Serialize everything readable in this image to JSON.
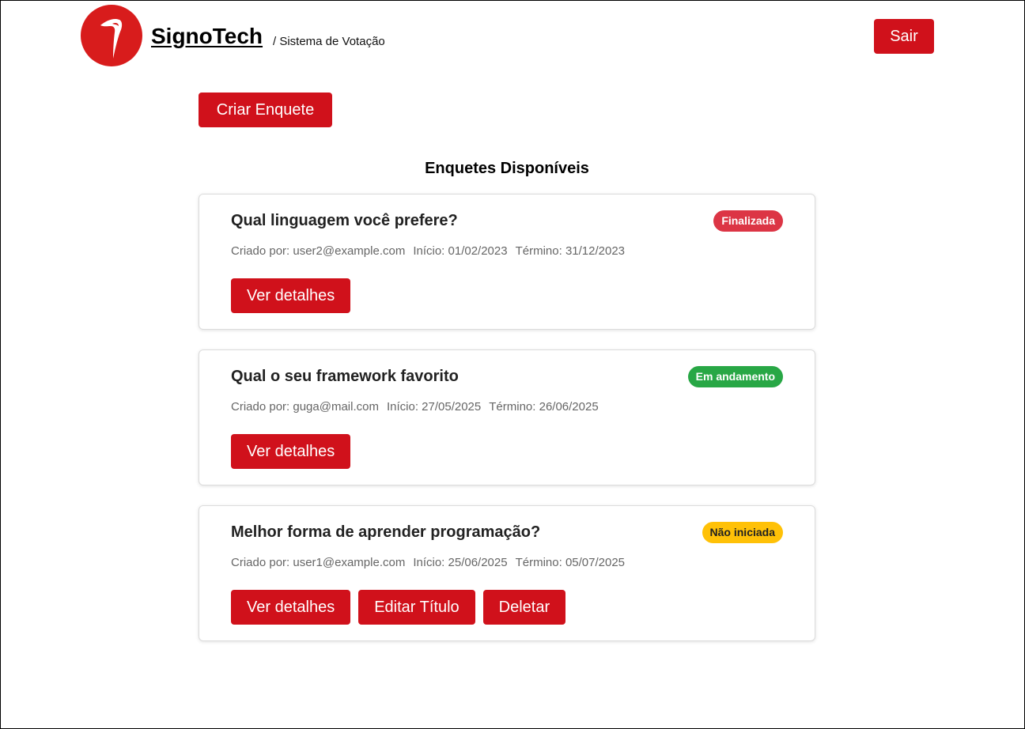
{
  "header": {
    "brand": "SignoTech",
    "subtitle": "/ Sistema de Votação",
    "logout_label": "Sair",
    "logo_color": "#d81c1c"
  },
  "toolbar": {
    "create_label": "Criar Enquete"
  },
  "section": {
    "title": "Enquetes Disponíveis"
  },
  "polls": [
    {
      "title": "Qual linguagem você prefere?",
      "status": "Finalizada",
      "status_color": "#dc3545",
      "status_text_color": "#ffffff",
      "created_by": "Criado por: user2@example.com",
      "start": "Início: 01/02/2023",
      "end": "Término: 31/12/2023",
      "actions": [
        "Ver detalhes"
      ]
    },
    {
      "title": "Qual o seu framework favorito",
      "status": "Em andamento",
      "status_color": "#28a745",
      "status_text_color": "#ffffff",
      "created_by": "Criado por: guga@mail.com",
      "start": "Início: 27/05/2025",
      "end": "Término: 26/06/2025",
      "actions": [
        "Ver detalhes"
      ]
    },
    {
      "title": "Melhor forma de aprender programação?",
      "status": "Não iniciada",
      "status_color": "#ffc107",
      "status_text_color": "#222222",
      "created_by": "Criado por: user1@example.com",
      "start": "Início: 25/06/2025",
      "end": "Término: 05/07/2025",
      "actions": [
        "Ver detalhes",
        "Editar Título",
        "Deletar"
      ]
    }
  ],
  "accent_color": "#d0111b"
}
